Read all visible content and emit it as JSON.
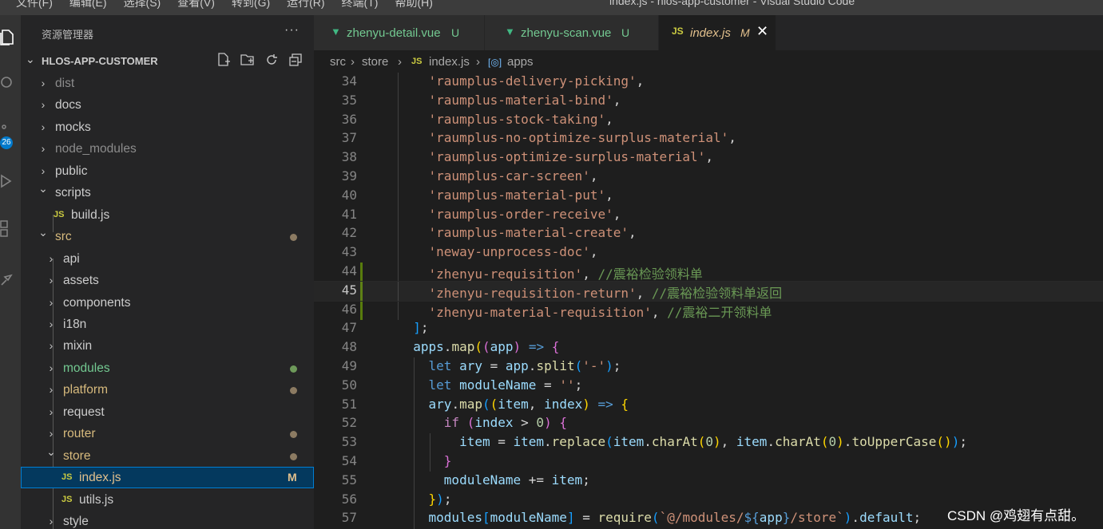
{
  "menubar": {
    "items": [
      "文件(F)",
      "编辑(E)",
      "选择(S)",
      "查看(V)",
      "转到(G)",
      "运行(R)",
      "终端(T)",
      "帮助(H)"
    ],
    "window_title": "index.js - hlos-app-customer - Visual Studio Code"
  },
  "activity_bar": {
    "icons": [
      "explorer-icon",
      "search-icon",
      "source-control-icon",
      "run-debug-icon",
      "extensions-icon",
      "tools-icon"
    ],
    "scm_badge": "26"
  },
  "sidebar": {
    "title": "资源管理器",
    "more": "···",
    "project": "HLOS-APP-CUSTOMER",
    "actions": [
      "new-file-icon",
      "new-folder-icon",
      "refresh-icon",
      "collapse-icon"
    ],
    "tree": [
      {
        "label": "dist",
        "type": "folder",
        "expanded": false,
        "depth": 0,
        "color": "#8c8c8c"
      },
      {
        "label": "docs",
        "type": "folder",
        "expanded": false,
        "depth": 0
      },
      {
        "label": "mocks",
        "type": "folder",
        "expanded": false,
        "depth": 0
      },
      {
        "label": "node_modules",
        "type": "folder",
        "expanded": false,
        "depth": 0,
        "color": "#8c8c8c"
      },
      {
        "label": "public",
        "type": "folder",
        "expanded": false,
        "depth": 0
      },
      {
        "label": "scripts",
        "type": "folder",
        "expanded": true,
        "depth": 0
      },
      {
        "label": "build.js",
        "type": "js",
        "depth": 1
      },
      {
        "label": "src",
        "type": "folder",
        "expanded": true,
        "depth": 0,
        "status": "dot",
        "color": "#d7ba7d"
      },
      {
        "label": "api",
        "type": "folder",
        "expanded": false,
        "depth": 1
      },
      {
        "label": "assets",
        "type": "folder",
        "expanded": false,
        "depth": 1
      },
      {
        "label": "components",
        "type": "folder",
        "expanded": false,
        "depth": 1
      },
      {
        "label": "i18n",
        "type": "folder",
        "expanded": false,
        "depth": 1
      },
      {
        "label": "mixin",
        "type": "folder",
        "expanded": false,
        "depth": 1
      },
      {
        "label": "modules",
        "type": "folder",
        "expanded": false,
        "depth": 1,
        "status": "dot-green",
        "color": "#73c991"
      },
      {
        "label": "platform",
        "type": "folder",
        "expanded": false,
        "depth": 1,
        "status": "dot",
        "color": "#d7ba7d"
      },
      {
        "label": "request",
        "type": "folder",
        "expanded": false,
        "depth": 1
      },
      {
        "label": "router",
        "type": "folder",
        "expanded": false,
        "depth": 1,
        "status": "dot",
        "color": "#d7ba7d"
      },
      {
        "label": "store",
        "type": "folder",
        "expanded": true,
        "depth": 1,
        "status": "dot",
        "color": "#d7ba7d"
      },
      {
        "label": "index.js",
        "type": "js",
        "depth": 2,
        "status": "M",
        "selected": true,
        "color": "#e2c08d"
      },
      {
        "label": "utils.js",
        "type": "js",
        "depth": 2
      },
      {
        "label": "style",
        "type": "folder",
        "expanded": false,
        "depth": 1
      }
    ]
  },
  "tabs": [
    {
      "label": "zhenyu-detail.vue",
      "status": "U",
      "icon": "vue-icon",
      "active": false
    },
    {
      "label": "zhenyu-scan.vue",
      "status": "U",
      "icon": "vue-icon",
      "active": false
    },
    {
      "label": "index.js",
      "status": "M",
      "icon": "JS",
      "active": true
    }
  ],
  "breadcrumb": [
    "src",
    "store",
    "index.js",
    "apps"
  ],
  "editor": {
    "current_line": 45,
    "lines": [
      {
        "n": 34,
        "t": [
          [
            "    ",
            "p"
          ],
          [
            "'raumplus-delivery-picking'",
            "s"
          ],
          [
            ",",
            "p"
          ]
        ]
      },
      {
        "n": 35,
        "t": [
          [
            "    ",
            "p"
          ],
          [
            "'raumplus-material-bind'",
            "s"
          ],
          [
            ",",
            "p"
          ]
        ]
      },
      {
        "n": 36,
        "t": [
          [
            "    ",
            "p"
          ],
          [
            "'raumplus-stock-taking'",
            "s"
          ],
          [
            ",",
            "p"
          ]
        ]
      },
      {
        "n": 37,
        "t": [
          [
            "    ",
            "p"
          ],
          [
            "'raumplus-no-optimize-surplus-material'",
            "s"
          ],
          [
            ",",
            "p"
          ]
        ]
      },
      {
        "n": 38,
        "t": [
          [
            "    ",
            "p"
          ],
          [
            "'raumplus-optimize-surplus-material'",
            "s"
          ],
          [
            ",",
            "p"
          ]
        ]
      },
      {
        "n": 39,
        "t": [
          [
            "    ",
            "p"
          ],
          [
            "'raumplus-car-screen'",
            "s"
          ],
          [
            ",",
            "p"
          ]
        ]
      },
      {
        "n": 40,
        "t": [
          [
            "    ",
            "p"
          ],
          [
            "'raumplus-material-put'",
            "s"
          ],
          [
            ",",
            "p"
          ]
        ]
      },
      {
        "n": 41,
        "t": [
          [
            "    ",
            "p"
          ],
          [
            "'raumplus-order-receive'",
            "s"
          ],
          [
            ",",
            "p"
          ]
        ]
      },
      {
        "n": 42,
        "t": [
          [
            "    ",
            "p"
          ],
          [
            "'raumplus-material-create'",
            "s"
          ],
          [
            ",",
            "p"
          ]
        ]
      },
      {
        "n": 43,
        "t": [
          [
            "    ",
            "p"
          ],
          [
            "'neway-unprocess-doc'",
            "s"
          ],
          [
            ",",
            "p"
          ]
        ]
      },
      {
        "n": 44,
        "t": [
          [
            "    ",
            "p"
          ],
          [
            "'zhenyu-requisition'",
            "s"
          ],
          [
            ", ",
            "p"
          ],
          [
            "//震裕检验领料单",
            "c"
          ]
        ]
      },
      {
        "n": 45,
        "t": [
          [
            "    ",
            "p"
          ],
          [
            "'zhenyu-requisition-return'",
            "s"
          ],
          [
            ", ",
            "p"
          ],
          [
            "//震裕检验领料单返回",
            "c"
          ]
        ]
      },
      {
        "n": 46,
        "t": [
          [
            "    ",
            "p"
          ],
          [
            "'zhenyu-material-requisition'",
            "s"
          ],
          [
            ", ",
            "p"
          ],
          [
            "//震裕二开领料单",
            "c"
          ]
        ]
      },
      {
        "n": 47,
        "t": [
          [
            "  ",
            "p"
          ],
          [
            "]",
            "b3"
          ],
          [
            ";",
            "p"
          ]
        ]
      },
      {
        "n": 48,
        "t": [
          [
            "  ",
            "p"
          ],
          [
            "apps",
            "v"
          ],
          [
            ".",
            "p"
          ],
          [
            "map",
            "f"
          ],
          [
            "(",
            "b1"
          ],
          [
            "(",
            "b2"
          ],
          [
            "app",
            "v"
          ],
          [
            ")",
            "b2"
          ],
          [
            " ",
            "p"
          ],
          [
            "=>",
            "k"
          ],
          [
            " ",
            "p"
          ],
          [
            "{",
            "b2"
          ]
        ]
      },
      {
        "n": 49,
        "t": [
          [
            "    ",
            "p"
          ],
          [
            "let",
            "k"
          ],
          [
            " ",
            "p"
          ],
          [
            "ary",
            "v"
          ],
          [
            " = ",
            "p"
          ],
          [
            "app",
            "v"
          ],
          [
            ".",
            "p"
          ],
          [
            "split",
            "f"
          ],
          [
            "(",
            "b3"
          ],
          [
            "'-'",
            "s"
          ],
          [
            ")",
            "b3"
          ],
          [
            ";",
            "p"
          ]
        ]
      },
      {
        "n": 50,
        "t": [
          [
            "    ",
            "p"
          ],
          [
            "let",
            "k"
          ],
          [
            " ",
            "p"
          ],
          [
            "moduleName",
            "v"
          ],
          [
            " = ",
            "p"
          ],
          [
            "''",
            "s"
          ],
          [
            ";",
            "p"
          ]
        ]
      },
      {
        "n": 51,
        "t": [
          [
            "    ",
            "p"
          ],
          [
            "ary",
            "v"
          ],
          [
            ".",
            "p"
          ],
          [
            "map",
            "f"
          ],
          [
            "(",
            "b3"
          ],
          [
            "(",
            "b1"
          ],
          [
            "item",
            "v"
          ],
          [
            ", ",
            "p"
          ],
          [
            "index",
            "v"
          ],
          [
            ")",
            "b1"
          ],
          [
            " ",
            "p"
          ],
          [
            "=>",
            "k"
          ],
          [
            " ",
            "p"
          ],
          [
            "{",
            "b1"
          ]
        ]
      },
      {
        "n": 52,
        "t": [
          [
            "      ",
            "p"
          ],
          [
            "if",
            "kw2"
          ],
          [
            " ",
            "p"
          ],
          [
            "(",
            "b2"
          ],
          [
            "index",
            "v"
          ],
          [
            " > ",
            "p"
          ],
          [
            "0",
            "n"
          ],
          [
            ")",
            "b2"
          ],
          [
            " ",
            "p"
          ],
          [
            "{",
            "b2"
          ]
        ]
      },
      {
        "n": 53,
        "t": [
          [
            "        ",
            "p"
          ],
          [
            "item",
            "v"
          ],
          [
            " = ",
            "p"
          ],
          [
            "item",
            "v"
          ],
          [
            ".",
            "p"
          ],
          [
            "replace",
            "f"
          ],
          [
            "(",
            "b3"
          ],
          [
            "item",
            "v"
          ],
          [
            ".",
            "p"
          ],
          [
            "charAt",
            "f"
          ],
          [
            "(",
            "b1"
          ],
          [
            "0",
            "n"
          ],
          [
            ")",
            "b1"
          ],
          [
            ", ",
            "p"
          ],
          [
            "item",
            "v"
          ],
          [
            ".",
            "p"
          ],
          [
            "charAt",
            "f"
          ],
          [
            "(",
            "b1"
          ],
          [
            "0",
            "n"
          ],
          [
            ")",
            "b1"
          ],
          [
            ".",
            "p"
          ],
          [
            "toUpperCase",
            "f"
          ],
          [
            "(",
            "b1"
          ],
          [
            ")",
            "b1"
          ],
          [
            ")",
            "b3"
          ],
          [
            ";",
            "p"
          ]
        ]
      },
      {
        "n": 54,
        "t": [
          [
            "      ",
            "p"
          ],
          [
            "}",
            "b2"
          ]
        ]
      },
      {
        "n": 55,
        "t": [
          [
            "      ",
            "p"
          ],
          [
            "moduleName",
            "v"
          ],
          [
            " += ",
            "p"
          ],
          [
            "item",
            "v"
          ],
          [
            ";",
            "p"
          ]
        ]
      },
      {
        "n": 56,
        "t": [
          [
            "    ",
            "p"
          ],
          [
            "}",
            "b1"
          ],
          [
            ")",
            "b3"
          ],
          [
            ";",
            "p"
          ]
        ]
      },
      {
        "n": 57,
        "t": [
          [
            "    ",
            "p"
          ],
          [
            "modules",
            "v"
          ],
          [
            "[",
            "b3"
          ],
          [
            "moduleName",
            "v"
          ],
          [
            "]",
            "b3"
          ],
          [
            " = ",
            "p"
          ],
          [
            "require",
            "f"
          ],
          [
            "(",
            "b3"
          ],
          [
            "`@/modules/",
            "t"
          ],
          [
            "${",
            "k"
          ],
          [
            "app",
            "v"
          ],
          [
            "}",
            "k"
          ],
          [
            "/store`",
            "t"
          ],
          [
            ")",
            "b3"
          ],
          [
            ".",
            "p"
          ],
          [
            "default",
            "v"
          ],
          [
            ";",
            "p"
          ]
        ]
      }
    ]
  },
  "watermark": "CSDN @鸡翅有点甜。",
  "colors": {
    "accent": "#007acc",
    "modified": "#e2c08d",
    "untracked": "#73c991",
    "vue": "#41b883"
  }
}
